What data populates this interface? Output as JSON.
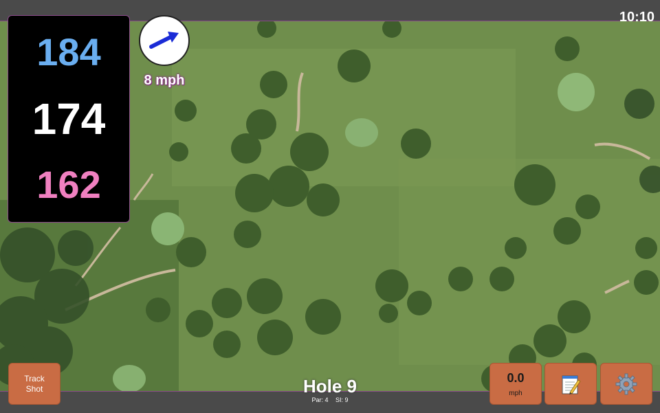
{
  "status": {
    "time": "10:10"
  },
  "yardages": {
    "back": "184",
    "middle": "174",
    "front": "162"
  },
  "wind": {
    "speed": "8 mph",
    "direction_icon": "wind-arrow-icon"
  },
  "hole": {
    "title": "Hole 9",
    "par": "Par: 4",
    "stroke_index": "SI: 9"
  },
  "buttons": {
    "track_shot_line1": "Track",
    "track_shot_line2": "Shot",
    "speed_value": "0.0",
    "speed_unit": "mph",
    "notes_icon": "notepad-icon",
    "settings_icon": "gear-icon"
  },
  "colors": {
    "back": "#6aaef0",
    "middle": "#ffffff",
    "front": "#f080c0",
    "button": "#c96c44",
    "accent_border": "#8e4c8e"
  }
}
